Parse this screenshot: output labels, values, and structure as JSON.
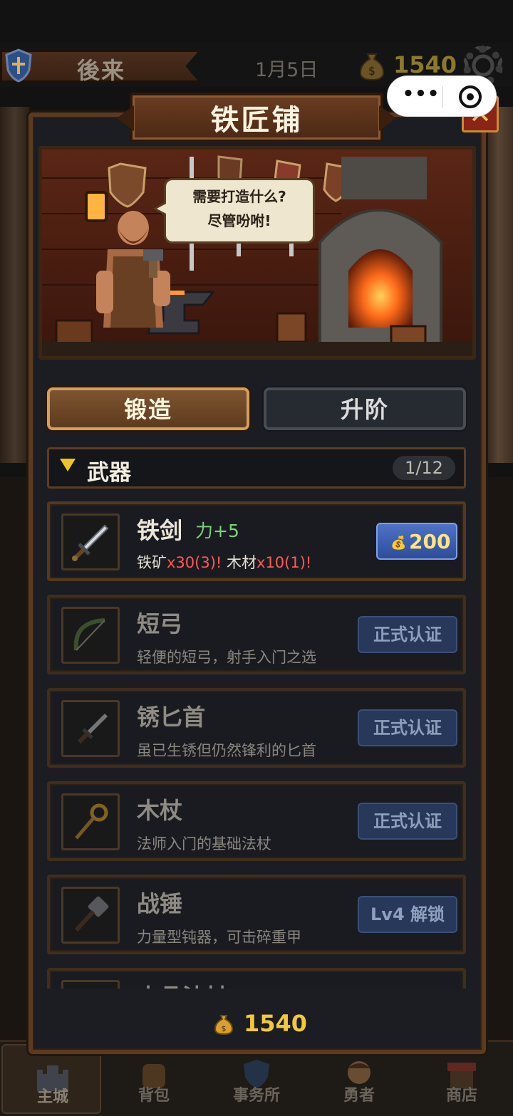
{
  "topbar": {
    "player_name": "後来",
    "date": "1月5日",
    "gold": "1540",
    "icons": [
      "shield-icon",
      "money-bag-icon",
      "gear-icon"
    ]
  },
  "capsule": {
    "menu_glyph": "•••"
  },
  "modal": {
    "title": "铁匠铺",
    "close_glyph": "✕",
    "speech": {
      "line1": "需要打造什么?",
      "line2": "尽管吩咐!"
    },
    "tabs": [
      {
        "label": "锻造",
        "active": true
      },
      {
        "label": "升阶",
        "active": false
      }
    ],
    "category": {
      "label": "武器",
      "count": "1/12"
    },
    "items": [
      {
        "name": "铁剑",
        "bonus": "力+5",
        "req_a_name": "铁矿",
        "req_a_amount": "x30(3)!",
        "req_b_name": "木材",
        "req_b_amount": "x10(1)!",
        "price": "200",
        "icon": "sword-icon",
        "locked": false
      },
      {
        "name": "短弓",
        "desc": "轻便的短弓，射手入门之选",
        "button": "正式认证",
        "icon": "bow-icon",
        "locked": true
      },
      {
        "name": "锈匕首",
        "desc": "虽已生锈但仍然锋利的匕首",
        "button": "正式认证",
        "icon": "dagger-icon",
        "locked": true
      },
      {
        "name": "木杖",
        "desc": "法师入门的基础法杖",
        "button": "正式认证",
        "icon": "staff-icon",
        "locked": true
      },
      {
        "name": "战锤",
        "desc": "力量型钝器，可击碎重甲",
        "button": "Lv4 解锁",
        "icon": "hammer-icon",
        "locked": true
      },
      {
        "name": "水晶法杖",
        "icon": "crystal-staff-icon",
        "locked": true
      }
    ],
    "footer_gold": "1540"
  },
  "bottom_nav": [
    {
      "label": "主城",
      "icon": "castle-icon",
      "active": true
    },
    {
      "label": "背包",
      "icon": "backpack-icon",
      "active": false
    },
    {
      "label": "事务所",
      "icon": "shield-icon",
      "active": false
    },
    {
      "label": "勇者",
      "icon": "hero-icon",
      "active": false
    },
    {
      "label": "商店",
      "icon": "shop-icon",
      "active": false
    }
  ],
  "colors": {
    "gold": "#f1c93c",
    "bonus_green": "#7fd27f",
    "warning_red": "#ff5a56",
    "frame_brown": "#5a3b22",
    "price_blue": "#3a5fb6"
  }
}
